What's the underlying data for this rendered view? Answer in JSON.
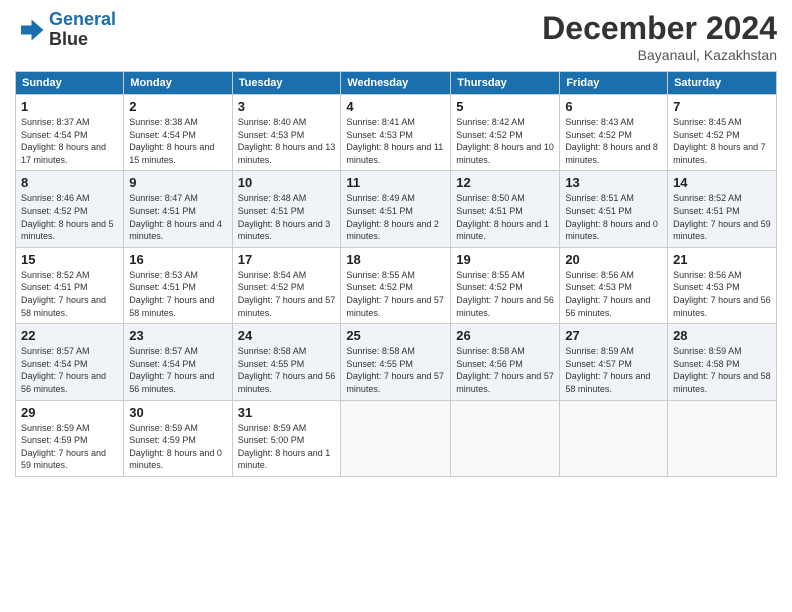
{
  "logo": {
    "line1": "General",
    "line2": "Blue"
  },
  "title": "December 2024",
  "subtitle": "Bayanaul, Kazakhstan",
  "days_of_week": [
    "Sunday",
    "Monday",
    "Tuesday",
    "Wednesday",
    "Thursday",
    "Friday",
    "Saturday"
  ],
  "weeks": [
    [
      {
        "day": "1",
        "sunrise": "Sunrise: 8:37 AM",
        "sunset": "Sunset: 4:54 PM",
        "daylight": "Daylight: 8 hours and 17 minutes."
      },
      {
        "day": "2",
        "sunrise": "Sunrise: 8:38 AM",
        "sunset": "Sunset: 4:54 PM",
        "daylight": "Daylight: 8 hours and 15 minutes."
      },
      {
        "day": "3",
        "sunrise": "Sunrise: 8:40 AM",
        "sunset": "Sunset: 4:53 PM",
        "daylight": "Daylight: 8 hours and 13 minutes."
      },
      {
        "day": "4",
        "sunrise": "Sunrise: 8:41 AM",
        "sunset": "Sunset: 4:53 PM",
        "daylight": "Daylight: 8 hours and 11 minutes."
      },
      {
        "day": "5",
        "sunrise": "Sunrise: 8:42 AM",
        "sunset": "Sunset: 4:52 PM",
        "daylight": "Daylight: 8 hours and 10 minutes."
      },
      {
        "day": "6",
        "sunrise": "Sunrise: 8:43 AM",
        "sunset": "Sunset: 4:52 PM",
        "daylight": "Daylight: 8 hours and 8 minutes."
      },
      {
        "day": "7",
        "sunrise": "Sunrise: 8:45 AM",
        "sunset": "Sunset: 4:52 PM",
        "daylight": "Daylight: 8 hours and 7 minutes."
      }
    ],
    [
      {
        "day": "8",
        "sunrise": "Sunrise: 8:46 AM",
        "sunset": "Sunset: 4:52 PM",
        "daylight": "Daylight: 8 hours and 5 minutes."
      },
      {
        "day": "9",
        "sunrise": "Sunrise: 8:47 AM",
        "sunset": "Sunset: 4:51 PM",
        "daylight": "Daylight: 8 hours and 4 minutes."
      },
      {
        "day": "10",
        "sunrise": "Sunrise: 8:48 AM",
        "sunset": "Sunset: 4:51 PM",
        "daylight": "Daylight: 8 hours and 3 minutes."
      },
      {
        "day": "11",
        "sunrise": "Sunrise: 8:49 AM",
        "sunset": "Sunset: 4:51 PM",
        "daylight": "Daylight: 8 hours and 2 minutes."
      },
      {
        "day": "12",
        "sunrise": "Sunrise: 8:50 AM",
        "sunset": "Sunset: 4:51 PM",
        "daylight": "Daylight: 8 hours and 1 minute."
      },
      {
        "day": "13",
        "sunrise": "Sunrise: 8:51 AM",
        "sunset": "Sunset: 4:51 PM",
        "daylight": "Daylight: 8 hours and 0 minutes."
      },
      {
        "day": "14",
        "sunrise": "Sunrise: 8:52 AM",
        "sunset": "Sunset: 4:51 PM",
        "daylight": "Daylight: 7 hours and 59 minutes."
      }
    ],
    [
      {
        "day": "15",
        "sunrise": "Sunrise: 8:52 AM",
        "sunset": "Sunset: 4:51 PM",
        "daylight": "Daylight: 7 hours and 58 minutes."
      },
      {
        "day": "16",
        "sunrise": "Sunrise: 8:53 AM",
        "sunset": "Sunset: 4:51 PM",
        "daylight": "Daylight: 7 hours and 58 minutes."
      },
      {
        "day": "17",
        "sunrise": "Sunrise: 8:54 AM",
        "sunset": "Sunset: 4:52 PM",
        "daylight": "Daylight: 7 hours and 57 minutes."
      },
      {
        "day": "18",
        "sunrise": "Sunrise: 8:55 AM",
        "sunset": "Sunset: 4:52 PM",
        "daylight": "Daylight: 7 hours and 57 minutes."
      },
      {
        "day": "19",
        "sunrise": "Sunrise: 8:55 AM",
        "sunset": "Sunset: 4:52 PM",
        "daylight": "Daylight: 7 hours and 56 minutes."
      },
      {
        "day": "20",
        "sunrise": "Sunrise: 8:56 AM",
        "sunset": "Sunset: 4:53 PM",
        "daylight": "Daylight: 7 hours and 56 minutes."
      },
      {
        "day": "21",
        "sunrise": "Sunrise: 8:56 AM",
        "sunset": "Sunset: 4:53 PM",
        "daylight": "Daylight: 7 hours and 56 minutes."
      }
    ],
    [
      {
        "day": "22",
        "sunrise": "Sunrise: 8:57 AM",
        "sunset": "Sunset: 4:54 PM",
        "daylight": "Daylight: 7 hours and 56 minutes."
      },
      {
        "day": "23",
        "sunrise": "Sunrise: 8:57 AM",
        "sunset": "Sunset: 4:54 PM",
        "daylight": "Daylight: 7 hours and 56 minutes."
      },
      {
        "day": "24",
        "sunrise": "Sunrise: 8:58 AM",
        "sunset": "Sunset: 4:55 PM",
        "daylight": "Daylight: 7 hours and 56 minutes."
      },
      {
        "day": "25",
        "sunrise": "Sunrise: 8:58 AM",
        "sunset": "Sunset: 4:55 PM",
        "daylight": "Daylight: 7 hours and 57 minutes."
      },
      {
        "day": "26",
        "sunrise": "Sunrise: 8:58 AM",
        "sunset": "Sunset: 4:56 PM",
        "daylight": "Daylight: 7 hours and 57 minutes."
      },
      {
        "day": "27",
        "sunrise": "Sunrise: 8:59 AM",
        "sunset": "Sunset: 4:57 PM",
        "daylight": "Daylight: 7 hours and 58 minutes."
      },
      {
        "day": "28",
        "sunrise": "Sunrise: 8:59 AM",
        "sunset": "Sunset: 4:58 PM",
        "daylight": "Daylight: 7 hours and 58 minutes."
      }
    ],
    [
      {
        "day": "29",
        "sunrise": "Sunrise: 8:59 AM",
        "sunset": "Sunset: 4:59 PM",
        "daylight": "Daylight: 7 hours and 59 minutes."
      },
      {
        "day": "30",
        "sunrise": "Sunrise: 8:59 AM",
        "sunset": "Sunset: 4:59 PM",
        "daylight": "Daylight: 8 hours and 0 minutes."
      },
      {
        "day": "31",
        "sunrise": "Sunrise: 8:59 AM",
        "sunset": "Sunset: 5:00 PM",
        "daylight": "Daylight: 8 hours and 1 minute."
      },
      null,
      null,
      null,
      null
    ]
  ],
  "colors": {
    "header_bg": "#1a6faf",
    "alt_row_bg": "#f0f4f8"
  }
}
